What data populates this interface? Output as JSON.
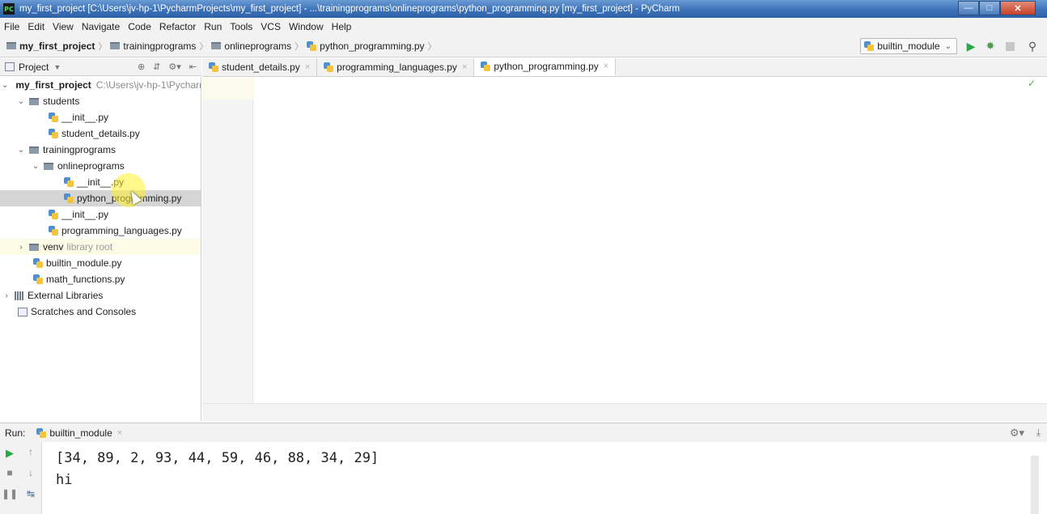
{
  "titlebar": {
    "app_icon": "PC",
    "title": "my_first_project [C:\\Users\\jv-hp-1\\PycharmProjects\\my_first_project] - ...\\trainingprograms\\onlineprograms\\python_programming.py [my_first_project] - PyCharm"
  },
  "menu": [
    "File",
    "Edit",
    "View",
    "Navigate",
    "Code",
    "Refactor",
    "Run",
    "Tools",
    "VCS",
    "Window",
    "Help"
  ],
  "navbar": {
    "crumbs": [
      "my_first_project",
      "trainingprograms",
      "onlineprograms",
      "python_programming.py"
    ],
    "run_config": "builtin_module"
  },
  "project_panel": {
    "title": "Project",
    "tree": [
      {
        "label": "my_first_project",
        "hint": "C:\\Users\\jv-hp-1\\Pycharm"
      },
      {
        "label": "students"
      },
      {
        "label": "__init__.py"
      },
      {
        "label": "student_details.py"
      },
      {
        "label": "trainingprograms"
      },
      {
        "label": "onlineprograms"
      },
      {
        "label": "__init__.py"
      },
      {
        "label": "python_programming.py"
      },
      {
        "label": "__init__.py"
      },
      {
        "label": "programming_languages.py"
      },
      {
        "label": "venv",
        "hint": "library root"
      },
      {
        "label": "builtin_module.py"
      },
      {
        "label": "math_functions.py"
      },
      {
        "label": "External Libraries"
      },
      {
        "label": "Scratches and Consoles"
      }
    ]
  },
  "tabs": [
    {
      "label": "student_details.py"
    },
    {
      "label": "programming_languages.py"
    },
    {
      "label": "python_programming.py",
      "active": true
    }
  ],
  "run_panel": {
    "label": "Run:",
    "tab": "builtin_module",
    "output": [
      "[34, 89, 2, 93, 44, 59, 46, 88, 34, 29]",
      "hi"
    ]
  },
  "colors": {
    "titlebar": "#3d72b8",
    "run_green": "#28a745",
    "selection": "#d5d5d5",
    "cursor_highlight": "#fff028"
  }
}
